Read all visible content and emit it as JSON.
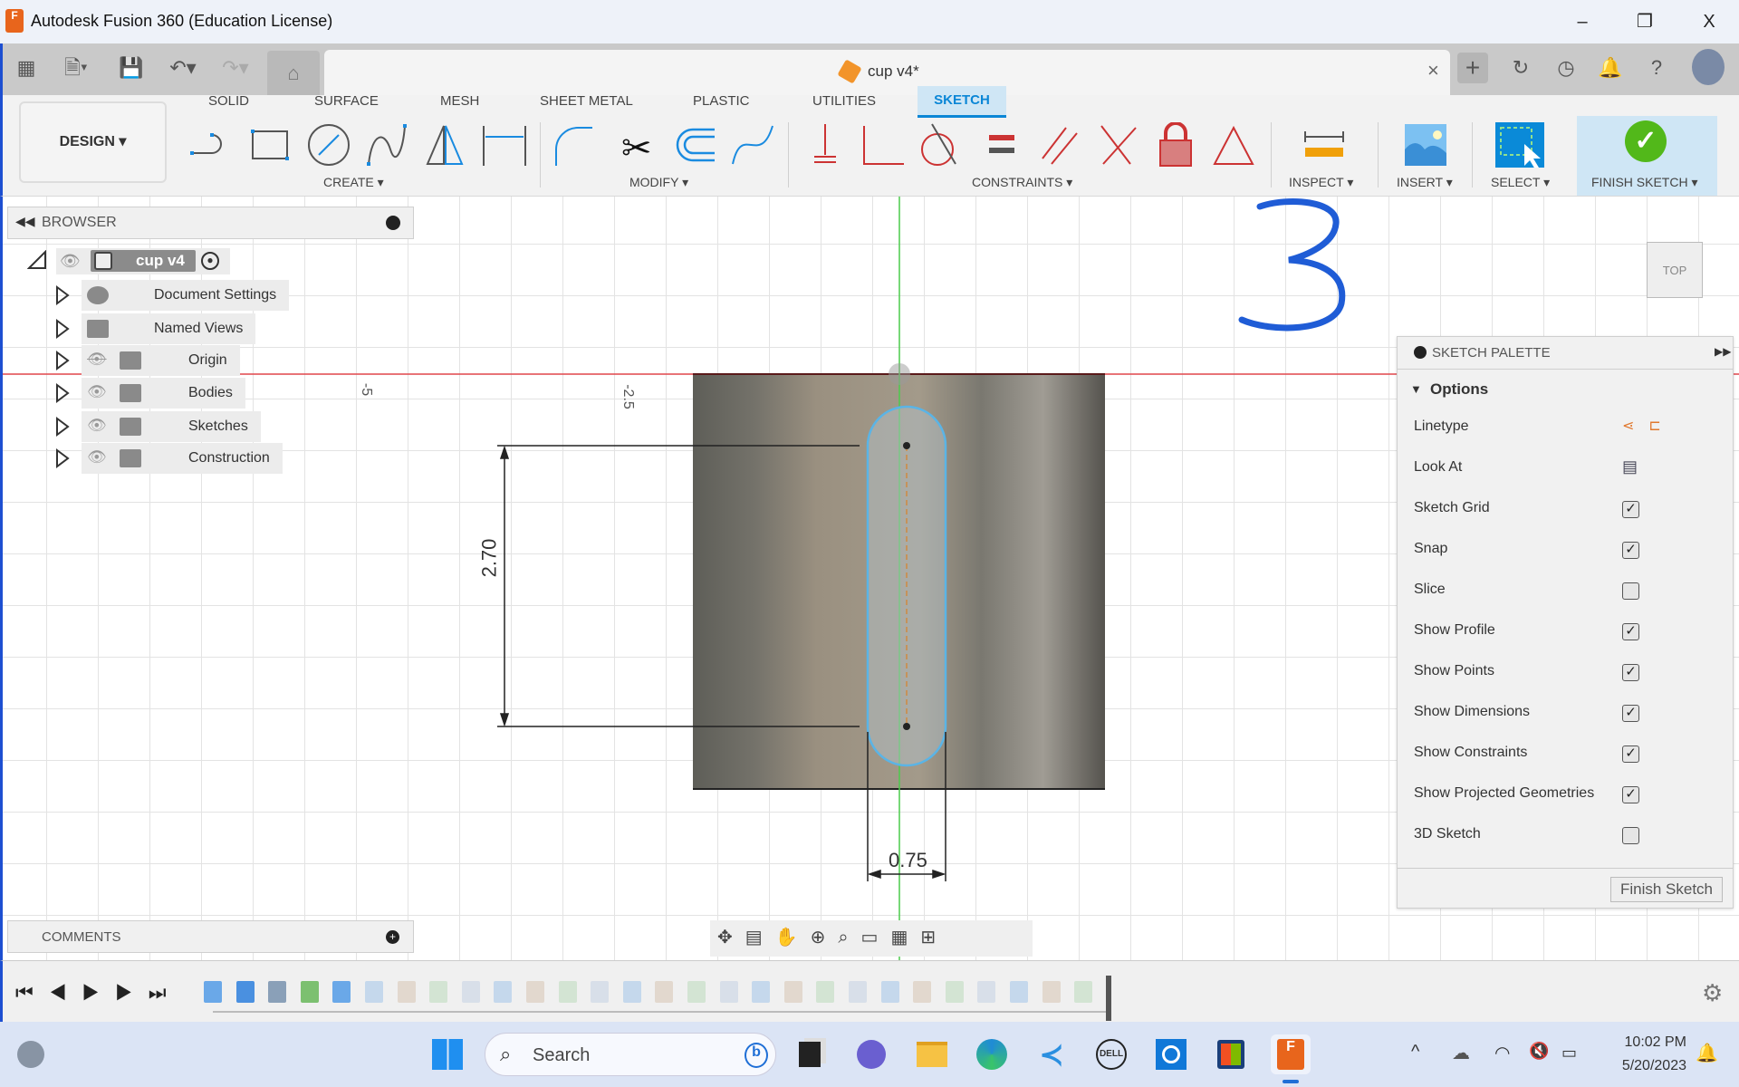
{
  "window": {
    "title": "Autodesk Fusion 360 (Education License)",
    "minimize": "–",
    "restore": "❐",
    "close": "X"
  },
  "doc_tab": {
    "title": "cup v4*",
    "close": "×"
  },
  "workspace": {
    "label": "DESIGN ▾"
  },
  "ribbon": {
    "tabs": [
      "SOLID",
      "SURFACE",
      "MESH",
      "SHEET METAL",
      "PLASTIC",
      "UTILITIES",
      "SKETCH"
    ],
    "active_tab": "SKETCH",
    "groups": {
      "create": "CREATE ▾",
      "modify": "MODIFY ▾",
      "constraints": "CONSTRAINTS ▾",
      "inspect": "INSPECT ▾",
      "insert": "INSERT ▾",
      "select": "SELECT ▾",
      "finish": "FINISH SKETCH ▾"
    }
  },
  "browser": {
    "title": "BROWSER",
    "root": "cup v4",
    "items": [
      {
        "label": "Document Settings",
        "icon": "gear"
      },
      {
        "label": "Named Views",
        "icon": "folder"
      },
      {
        "label": "Origin",
        "icon": "folder",
        "hidden": true
      },
      {
        "label": "Bodies",
        "icon": "folder"
      },
      {
        "label": "Sketches",
        "icon": "folder"
      },
      {
        "label": "Construction",
        "icon": "folder"
      }
    ]
  },
  "comments": {
    "title": "COMMENTS"
  },
  "canvas": {
    "axis_labels": [
      "-5",
      "-2.5"
    ],
    "dimensions": {
      "height": "2.70",
      "width": "0.75"
    },
    "annotation": "3",
    "viewcube": "TOP",
    "colors": {
      "x_axis": "#e0474c",
      "y_axis": "#4ccb4c",
      "sketch": "#5ab4e6"
    }
  },
  "palette": {
    "title": "SKETCH PALETTE",
    "section": "Options",
    "rows": [
      {
        "label": "Linetype",
        "type": "icons"
      },
      {
        "label": "Look At",
        "type": "icon"
      },
      {
        "label": "Sketch Grid",
        "checked": true
      },
      {
        "label": "Snap",
        "checked": true
      },
      {
        "label": "Slice",
        "checked": false
      },
      {
        "label": "Show Profile",
        "checked": true
      },
      {
        "label": "Show Points",
        "checked": true
      },
      {
        "label": "Show Dimensions",
        "checked": true
      },
      {
        "label": "Show Constraints",
        "checked": true
      },
      {
        "label": "Show Projected Geometries",
        "checked": true
      },
      {
        "label": "3D Sketch",
        "checked": false
      }
    ],
    "finish_button": "Finish Sketch"
  },
  "taskbar": {
    "search_placeholder": "Search",
    "time": "10:02 PM",
    "date": "5/20/2023"
  }
}
